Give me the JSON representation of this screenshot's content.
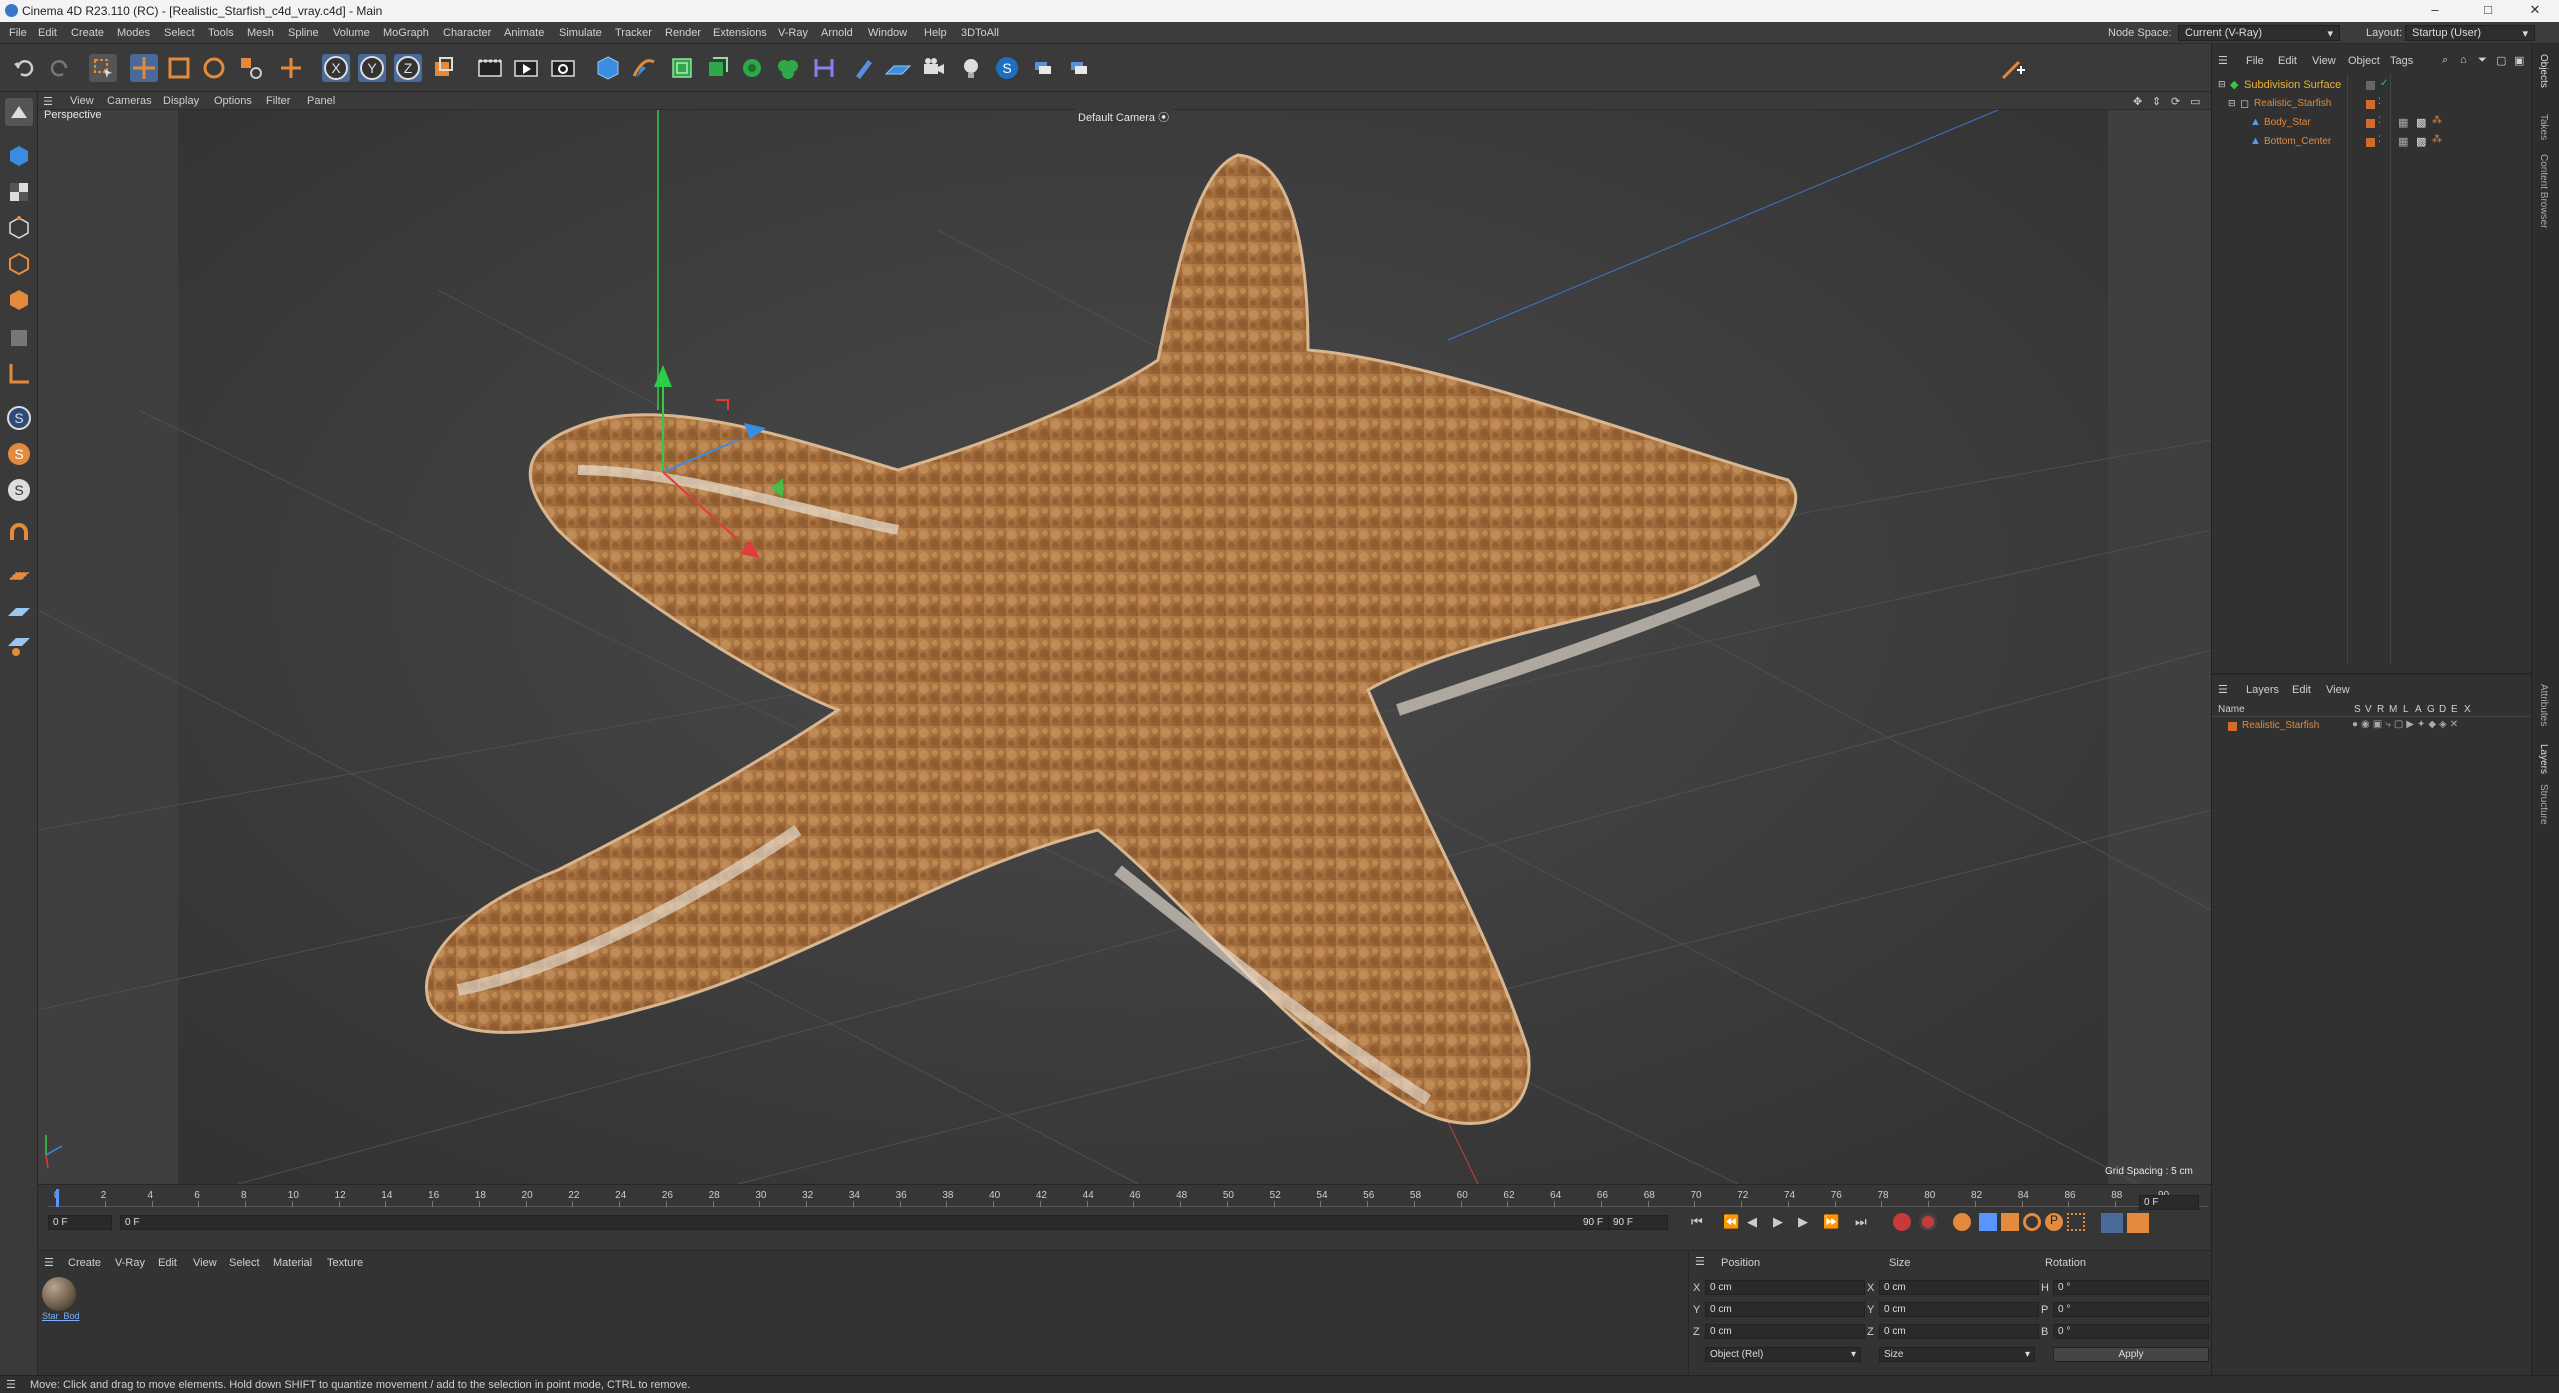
{
  "window": {
    "title": "Cinema 4D R23.110 (RC) - [Realistic_Starfish_c4d_vray.c4d] - Main",
    "controls": [
      "–",
      "□",
      "✕"
    ]
  },
  "menu": [
    "File",
    "Edit",
    "Create",
    "Modes",
    "Select",
    "Tools",
    "Mesh",
    "Spline",
    "Volume",
    "MoGraph",
    "Character",
    "Animate",
    "Simulate",
    "Tracker",
    "Render",
    "Extensions",
    "V-Ray",
    "Arnold",
    "Window",
    "Help",
    "3DToAll"
  ],
  "node_space": {
    "label": "Node Space:",
    "value": "Current (V-Ray)"
  },
  "layout": {
    "label": "Layout:",
    "value": "Startup (User)"
  },
  "toolbar_icons": [
    "undo-icon",
    "redo-icon",
    "live-selection-icon",
    "move-icon",
    "scale-icon",
    "rotate-icon",
    "recent-tools-icon",
    "add-icon",
    "x-axis-icon",
    "y-axis-icon",
    "z-axis-icon",
    "coordinate-system-icon",
    "render-region-icon",
    "render-view-icon",
    "render-settings-icon",
    "cube-icon",
    "pen-icon",
    "subdivision-icon",
    "extrude-icon",
    "cloner-icon",
    "boole-icon",
    "deformer-icon",
    "tag-icon",
    "floor-icon",
    "camera-icon",
    "light-icon",
    "vray-icon",
    "python-icon",
    "python2-icon"
  ],
  "viewport": {
    "menu": [
      "View",
      "Cameras",
      "Display",
      "Options",
      "Filter",
      "Panel"
    ],
    "label": "Perspective",
    "camera": "Default Camera",
    "grid_spacing": "Grid Spacing : 5 cm"
  },
  "timeline": {
    "ticks": [
      "0",
      "2",
      "4",
      "6",
      "8",
      "10",
      "12",
      "14",
      "16",
      "18",
      "20",
      "22",
      "24",
      "26",
      "28",
      "30",
      "32",
      "34",
      "36",
      "38",
      "40",
      "42",
      "44",
      "46",
      "48",
      "50",
      "52",
      "54",
      "56",
      "58",
      "60",
      "62",
      "64",
      "66",
      "68",
      "70",
      "72",
      "74",
      "76",
      "78",
      "80",
      "82",
      "84",
      "86",
      "88",
      "90"
    ],
    "current": "0 F",
    "start": "0 F",
    "range_start": "0 F",
    "range_end": "90 F",
    "end": "90 F",
    "frame_display": "0 F"
  },
  "materials": {
    "menu": [
      "Create",
      "V-Ray",
      "Edit",
      "View",
      "Select",
      "Material",
      "Texture"
    ],
    "items": [
      {
        "name": "Star_Bod"
      }
    ]
  },
  "attributes": {
    "headers": [
      "Position",
      "Size",
      "Rotation"
    ],
    "rows": [
      {
        "axis": "X",
        "pos": "0 cm",
        "size_axis": "X",
        "size": "0 cm",
        "rot_axis": "H",
        "rot": "0 °"
      },
      {
        "axis": "Y",
        "pos": "0 cm",
        "size_axis": "Y",
        "size": "0 cm",
        "rot_axis": "P",
        "rot": "0 °"
      },
      {
        "axis": "Z",
        "pos": "0 cm",
        "size_axis": "Z",
        "size": "0 cm",
        "rot_axis": "B",
        "rot": "0 °"
      }
    ],
    "mode": "Object (Rel)",
    "size_mode": "Size",
    "apply": "Apply"
  },
  "objects": {
    "menu": [
      "File",
      "Edit",
      "View",
      "Object",
      "Tags"
    ],
    "tree": [
      {
        "name": "Subdivision Surface",
        "color": "#e8b23a",
        "indent": 0
      },
      {
        "name": "Realistic_Starfish",
        "color": "#e38a3c",
        "indent": 1
      },
      {
        "name": "Body_Star",
        "color": "#e38a3c",
        "indent": 2
      },
      {
        "name": "Bottom_Center",
        "color": "#e38a3c",
        "indent": 2
      }
    ]
  },
  "layers": {
    "menu": [
      "Layers",
      "Edit",
      "View"
    ],
    "col_name": "Name",
    "col_flags": [
      "S",
      "V",
      "R",
      "M",
      "L",
      "A",
      "G",
      "D",
      "E",
      "X"
    ],
    "items": [
      {
        "name": "Realistic_Starfish"
      }
    ]
  },
  "sidetabs": [
    "Objects",
    "Takes",
    "Content Browser",
    "Attributes",
    "Layers",
    "Structure"
  ],
  "status": "Move: Click and drag to move elements. Hold down SHIFT to quantize movement / add to the selection in point mode, CTRL to remove.",
  "colors": {
    "accent": "#e38a3c",
    "axis_x": "#e03c3c",
    "axis_y": "#2fcc4a",
    "axis_z": "#3a8de0"
  }
}
